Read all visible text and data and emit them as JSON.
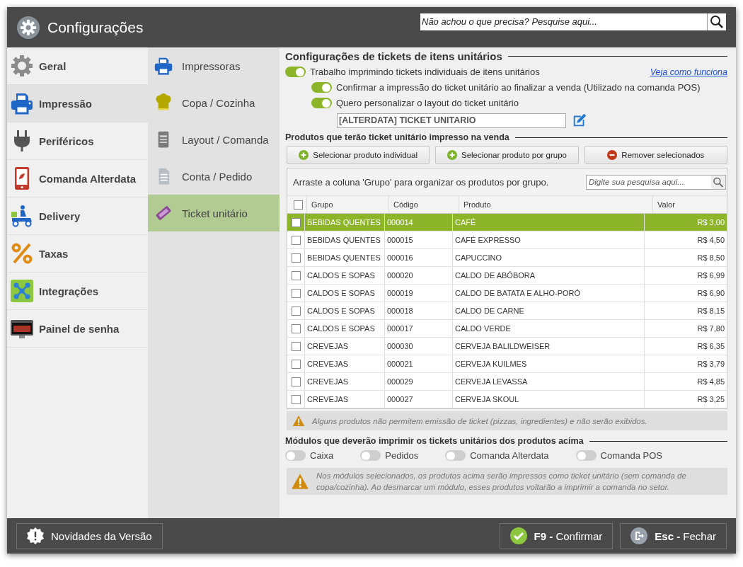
{
  "window": {
    "title": "Configurações"
  },
  "search": {
    "placeholder": "Não achou o que precisa? Pesquise aqui..."
  },
  "sidebar": {
    "items": [
      {
        "label": "Geral",
        "selected": false
      },
      {
        "label": "Impressão",
        "selected": true
      },
      {
        "label": "Periféricos",
        "selected": false
      },
      {
        "label": "Comanda Alterdata",
        "selected": false
      },
      {
        "label": "Delivery",
        "selected": false
      },
      {
        "label": "Taxas",
        "selected": false
      },
      {
        "label": "Integrações",
        "selected": false
      },
      {
        "label": "Painel de senha",
        "selected": false
      }
    ]
  },
  "subnav": {
    "items": [
      {
        "label": "Impressoras",
        "selected": false
      },
      {
        "label": "Copa / Cozinha",
        "selected": false
      },
      {
        "label": "Layout / Comanda",
        "selected": false
      },
      {
        "label": "Conta / Pedido",
        "selected": false
      },
      {
        "label": "Ticket unitário",
        "selected": true
      }
    ]
  },
  "content": {
    "section_title": "Configurações de tickets de itens unitários",
    "help_link": "Veja como funciona",
    "options": [
      {
        "label": "Trabalho imprimindo tickets individuais de itens unitários",
        "on": true,
        "nested": false
      },
      {
        "label": "Confirmar a impressão do ticket unitário ao finalizar a venda (Utilizado na comanda POS)",
        "on": true,
        "nested": true
      },
      {
        "label": "Quero personalizar o layout do ticket unitário",
        "on": true,
        "nested": true
      }
    ],
    "layout_field": {
      "value": "[ALTERDATA] TICKET UNITARIO"
    },
    "products_title": "Produtos que terão ticket unitário impresso na venda",
    "buttons": [
      {
        "label": "Selecionar produto individual",
        "kind": "add"
      },
      {
        "label": "Selecionar produto por grupo",
        "kind": "add"
      },
      {
        "label": "Remover selecionados",
        "kind": "remove"
      }
    ],
    "table": {
      "hint": "Arraste a coluna 'Grupo' para organizar os produtos por grupo.",
      "search_placeholder": "Digite sua pesquisa aqui...",
      "header_checked": false,
      "columns": [
        "Grupo",
        "Código",
        "Produto",
        "Valor"
      ],
      "rows": [
        {
          "cells": [
            "BEBIDAS QUENTES",
            "000014",
            "CAFÉ",
            "R$ 3,00"
          ],
          "checked": false,
          "selected": true
        },
        {
          "cells": [
            "BEBIDAS QUENTES",
            "000015",
            "CAFÉ EXPRESSO",
            "R$ 4,50"
          ],
          "checked": false,
          "selected": false
        },
        {
          "cells": [
            "BEBIDAS QUENTES",
            "000016",
            "CAPUCCINO",
            "R$ 8,50"
          ],
          "checked": false,
          "selected": false
        },
        {
          "cells": [
            "CALDOS E SOPAS",
            "000020",
            "CALDO DE ABÓBORA",
            "R$ 6,99"
          ],
          "checked": false,
          "selected": false
        },
        {
          "cells": [
            "CALDOS E SOPAS",
            "000019",
            "CALDO DE BATATA E ALHO-PORÓ",
            "R$ 6,90"
          ],
          "checked": false,
          "selected": false
        },
        {
          "cells": [
            "CALDOS E SOPAS",
            "000018",
            "CALDO DE CARNE",
            "R$ 8,15"
          ],
          "checked": false,
          "selected": false
        },
        {
          "cells": [
            "CALDOS E SOPAS",
            "000017",
            "CALDO VERDE",
            "R$ 7,80"
          ],
          "checked": false,
          "selected": false
        },
        {
          "cells": [
            "CREVEJAS",
            "000030",
            "CERVEJA BALILDWEISER",
            "R$ 6,35"
          ],
          "checked": false,
          "selected": false
        },
        {
          "cells": [
            "CREVEJAS",
            "000021",
            "CERVEJA KUILMES",
            "R$ 3,79"
          ],
          "checked": false,
          "selected": false
        },
        {
          "cells": [
            "CREVEJAS",
            "000029",
            "CERVEJA LEVASSA",
            "R$ 4,85"
          ],
          "checked": false,
          "selected": false
        },
        {
          "cells": [
            "CREVEJAS",
            "000027",
            "CERVEJA SKOUL",
            "R$ 3,25"
          ],
          "checked": false,
          "selected": false
        }
      ]
    },
    "table_note": "Alguns produtos não permitem emissão de ticket (pizzas, ingredientes) e não serão exibidos.",
    "modules_title": "Módulos que deverão imprimir os tickets unitários dos produtos acima",
    "modules": [
      {
        "label": "Caixa",
        "on": false
      },
      {
        "label": "Pedidos",
        "on": false
      },
      {
        "label": "Comanda Alterdata",
        "on": false
      },
      {
        "label": "Comanda POS",
        "on": false
      }
    ],
    "modules_note": "Nos módulos selecionados, os produtos acima serão impressos como ticket unitário (sem comanda de copa/cozinha). Ao desmarcar um módulo, esses produtos voltarão a imprimir a comanda no setor."
  },
  "footer": {
    "news_button": "Novidades da Versão",
    "confirm_button": "**F9 -** Confirmar",
    "close_button": "**Esc -** Fechar"
  }
}
